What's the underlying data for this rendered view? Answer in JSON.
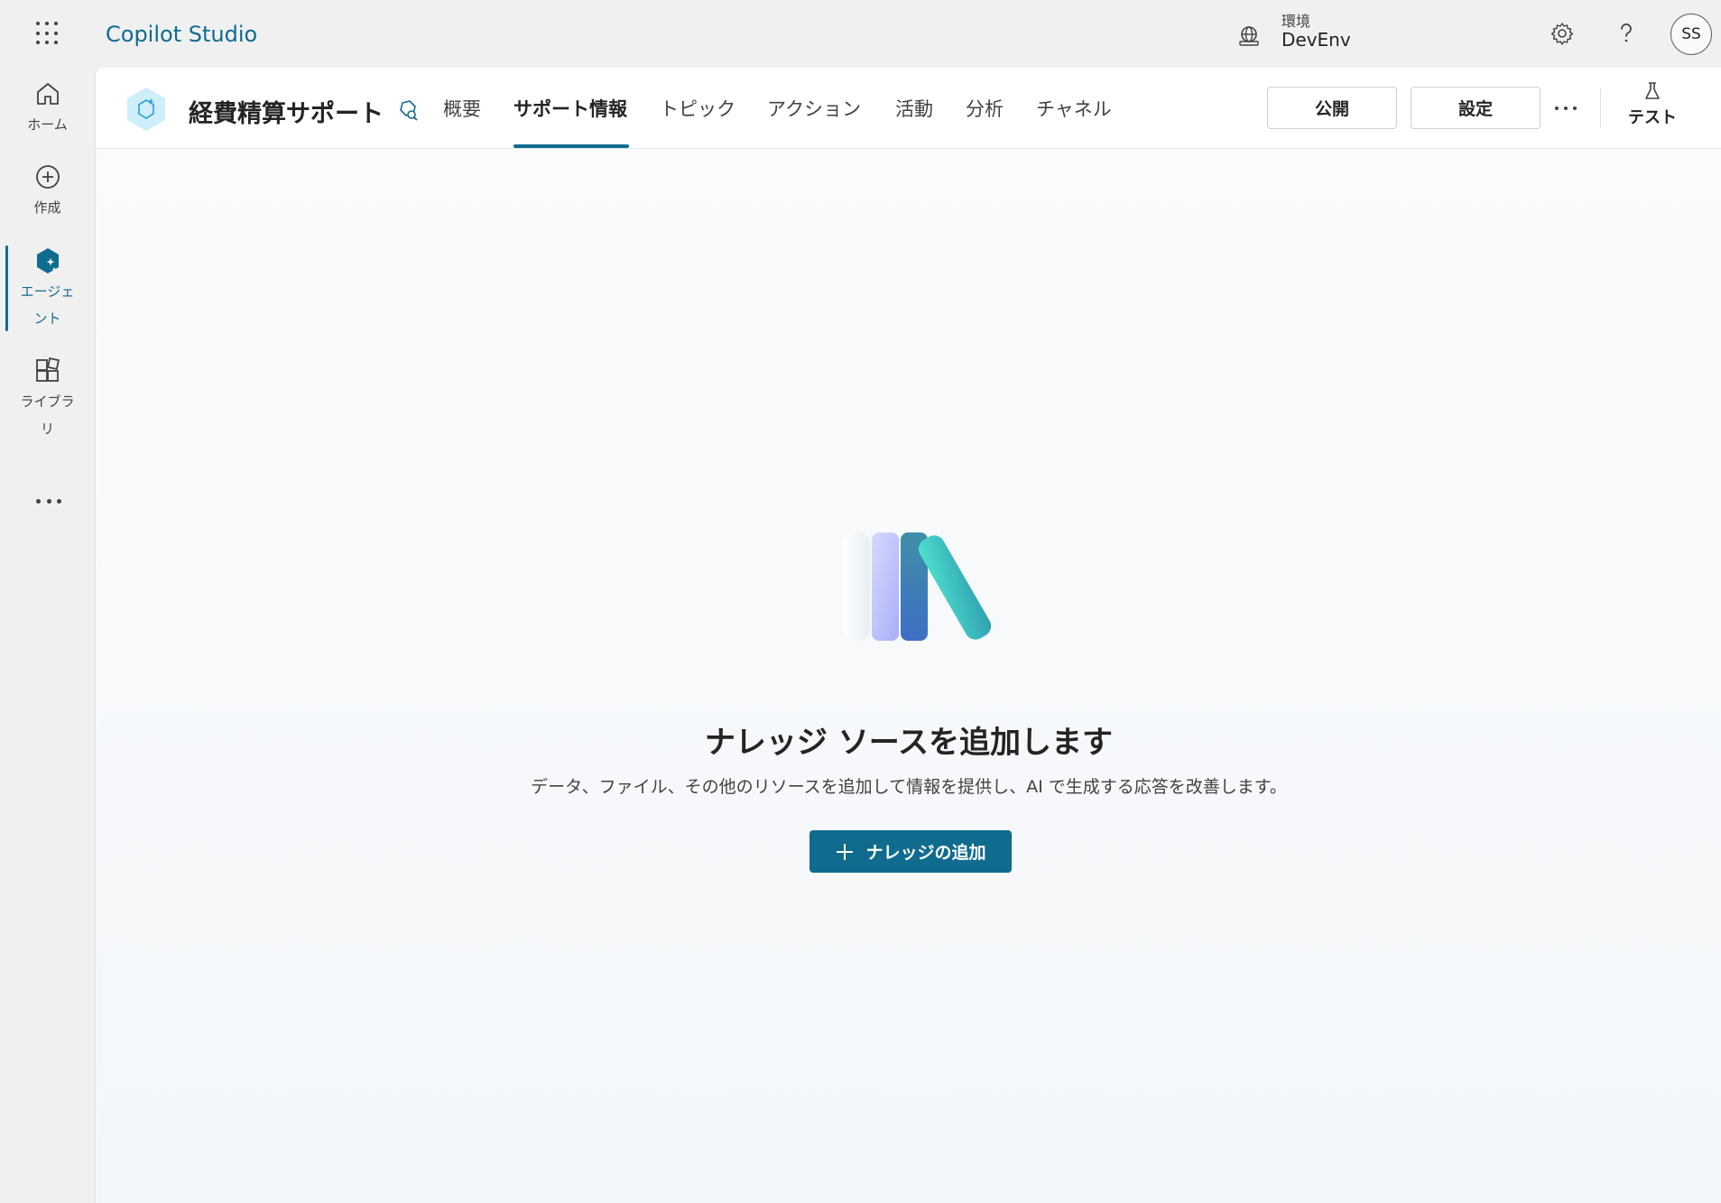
{
  "topbar": {
    "app_title": "Copilot Studio",
    "environment_label": "環境",
    "environment_value": "DevEnv",
    "avatar_initials": "SS"
  },
  "rail": {
    "items": [
      {
        "label": "ホーム",
        "icon": "home-icon"
      },
      {
        "label": "作成",
        "icon": "add-circle-icon"
      },
      {
        "label": "エージェ\nント",
        "icon": "agent-icon",
        "active": true
      },
      {
        "label": "ライブラ\nリ",
        "icon": "library-icon"
      }
    ]
  },
  "agent": {
    "name": "経費精算サポート"
  },
  "tabs": [
    {
      "label": "概要"
    },
    {
      "label": "サポート情報",
      "active": true
    },
    {
      "label": "トピック"
    },
    {
      "label": "アクション"
    },
    {
      "label": "活動"
    },
    {
      "label": "分析"
    },
    {
      "label": "チャネル"
    }
  ],
  "actions": {
    "publish_label": "公開",
    "settings_label": "設定",
    "test_label": "テスト"
  },
  "empty_state": {
    "title": "ナレッジ ソースを追加します",
    "description": "データ、ファイル、その他のリソースを追加して情報を提供し、AI で生成する応答を改善します。",
    "button_label": "ナレッジの追加"
  },
  "colors": {
    "accent": "#0f6c8f",
    "background": "#f0f0f0"
  }
}
